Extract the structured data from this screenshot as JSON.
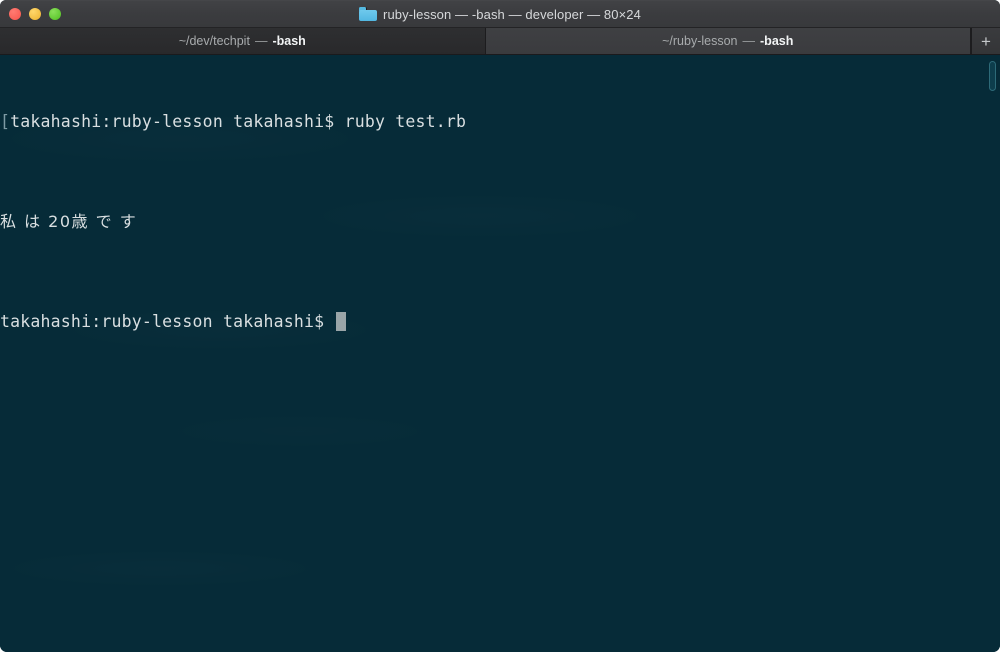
{
  "window": {
    "title": "ruby-lesson — -bash — developer — 80×24",
    "folder_icon": "folder-icon",
    "traffic_lights": {
      "close_label": "",
      "minimize_label": "",
      "zoom_label": "",
      "close_color": "#f8544b",
      "minimize_color": "#ecb22e",
      "zoom_color": "#4fc020"
    },
    "chrome_color": "#3b3c3f"
  },
  "tabs": {
    "items": [
      {
        "path": "~/dev/techpit",
        "dash": "—",
        "shell": "-bash",
        "active": false
      },
      {
        "path": "~/ruby-lesson",
        "dash": "—",
        "shell": "-bash",
        "active": true
      }
    ],
    "new_tab_label": "+"
  },
  "terminal": {
    "background_color": "#062b38",
    "foreground_color": "#d9dfe1",
    "cursor_color": "#9aa5a8",
    "lines": [
      {
        "lead": "[",
        "prompt": "takahashi:ruby-lesson takahashi$ ",
        "command": "ruby test.rb"
      },
      {
        "output_jp": "私 は 20歳 で す"
      },
      {
        "prompt": "takahashi:ruby-lesson takahashi$ ",
        "command": ""
      }
    ]
  }
}
